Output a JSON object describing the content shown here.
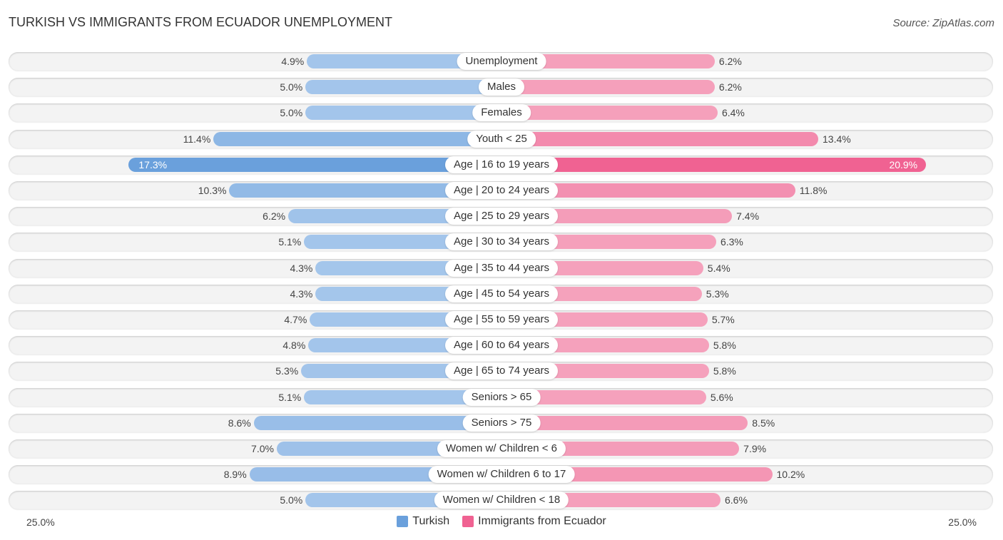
{
  "title": "TURKISH VS IMMIGRANTS FROM ECUADOR UNEMPLOYMENT",
  "source": "Source: ZipAtlas.com",
  "colors": {
    "turkish": "#6aa0dc",
    "turkish_light": "#a8c8ec",
    "ecuador": "#f06292",
    "ecuador_light": "#f5a6bf"
  },
  "chart_data": {
    "type": "bar",
    "orientation": "horizontal-diverging",
    "title": "TURKISH VS IMMIGRANTS FROM ECUADOR UNEMPLOYMENT",
    "categories": [
      "Unemployment",
      "Males",
      "Females",
      "Youth < 25",
      "Age | 16 to 19 years",
      "Age | 20 to 24 years",
      "Age | 25 to 29 years",
      "Age | 30 to 34 years",
      "Age | 35 to 44 years",
      "Age | 45 to 54 years",
      "Age | 55 to 59 years",
      "Age | 60 to 64 years",
      "Age | 65 to 74 years",
      "Seniors > 65",
      "Seniors > 75",
      "Women w/ Children < 6",
      "Women w/ Children 6 to 17",
      "Women w/ Children < 18"
    ],
    "series": [
      {
        "name": "Turkish",
        "values": [
          4.9,
          5.0,
          5.0,
          11.4,
          17.3,
          10.3,
          6.2,
          5.1,
          4.3,
          4.3,
          4.7,
          4.8,
          5.3,
          5.1,
          8.6,
          7.0,
          8.9,
          5.0
        ]
      },
      {
        "name": "Immigrants from Ecuador",
        "values": [
          6.2,
          6.2,
          6.4,
          13.4,
          20.9,
          11.8,
          7.4,
          6.3,
          5.4,
          5.3,
          5.7,
          5.8,
          5.8,
          5.6,
          8.5,
          7.9,
          10.2,
          6.6
        ]
      }
    ],
    "value_labels_left": [
      "4.9%",
      "5.0%",
      "5.0%",
      "11.4%",
      "17.3%",
      "10.3%",
      "6.2%",
      "5.1%",
      "4.3%",
      "4.3%",
      "4.7%",
      "4.8%",
      "5.3%",
      "5.1%",
      "8.6%",
      "7.0%",
      "8.9%",
      "5.0%"
    ],
    "value_labels_right": [
      "6.2%",
      "6.2%",
      "6.4%",
      "13.4%",
      "20.9%",
      "11.8%",
      "7.4%",
      "6.3%",
      "5.4%",
      "5.3%",
      "5.7%",
      "5.8%",
      "5.8%",
      "5.6%",
      "8.5%",
      "7.9%",
      "10.2%",
      "6.6%"
    ],
    "xlim": [
      -25,
      25
    ],
    "axis_labels": {
      "left": "25.0%",
      "right": "25.0%"
    },
    "legend": {
      "position": "bottom-center",
      "entries": [
        "Turkish",
        "Immigrants from Ecuador"
      ]
    },
    "highlighted_row": 4
  }
}
